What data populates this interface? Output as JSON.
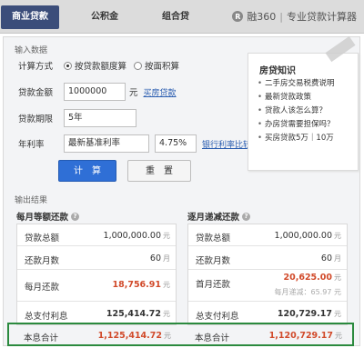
{
  "tabs": [
    {
      "label": "商业贷款",
      "active": true
    },
    {
      "label": "公积金",
      "active": false
    },
    {
      "label": "组合贷",
      "active": false
    }
  ],
  "brand": {
    "logo_text": "融360",
    "separator": "|",
    "tagline": "专业贷款计算器"
  },
  "input_section": {
    "title": "输入数据",
    "calc_method": {
      "label": "计算方式",
      "options": [
        {
          "label": "按贷款额度算",
          "selected": true
        },
        {
          "label": "按面积算",
          "selected": false
        }
      ]
    },
    "loan_amount": {
      "label": "贷款金额",
      "value": "1000000",
      "unit": "元",
      "link": "买房贷款"
    },
    "loan_term": {
      "label": "贷款期限",
      "value": "5年"
    },
    "rate": {
      "label": "年利率",
      "value": "最新基准利率",
      "percent": "4.75%",
      "link": "银行利率比较"
    },
    "calc_button": "计　算",
    "reset_button": "重　置"
  },
  "knowledge": {
    "title": "房贷知识",
    "items": [
      "二手房交易税费说明",
      "最新贷款政策",
      "贷款人该怎么算？",
      "办房贷需要担保吗？",
      "买房贷款5万｜10万"
    ]
  },
  "output_section": {
    "title": "输出结果",
    "equal_payment": {
      "title": "每月等额还款",
      "rows": [
        {
          "label": "贷款总额",
          "value": "1,000,000.00",
          "unit": "元"
        },
        {
          "label": "还款月数",
          "value": "60",
          "unit": "月"
        },
        {
          "label": "每月还款",
          "value": "18,756.91",
          "unit": "元"
        },
        {
          "label": "总支付利息",
          "value": "125,414.72",
          "unit": "元"
        }
      ],
      "total": {
        "label": "本息合计",
        "value": "1,125,414.72",
        "unit": "元"
      }
    },
    "decreasing_payment": {
      "title": "逐月递减还款",
      "rows": [
        {
          "label": "贷款总额",
          "value": "1,000,000.00",
          "unit": "元"
        },
        {
          "label": "还款月数",
          "value": "60",
          "unit": "月"
        },
        {
          "label": "首月还款",
          "value": "20,625.00",
          "unit": "元",
          "sub": "每月递减：65.97 元"
        },
        {
          "label": "总支付利息",
          "value": "120,729.17",
          "unit": "元"
        }
      ],
      "total": {
        "label": "本息合计",
        "value": "1,120,729.17",
        "unit": "元"
      }
    }
  }
}
